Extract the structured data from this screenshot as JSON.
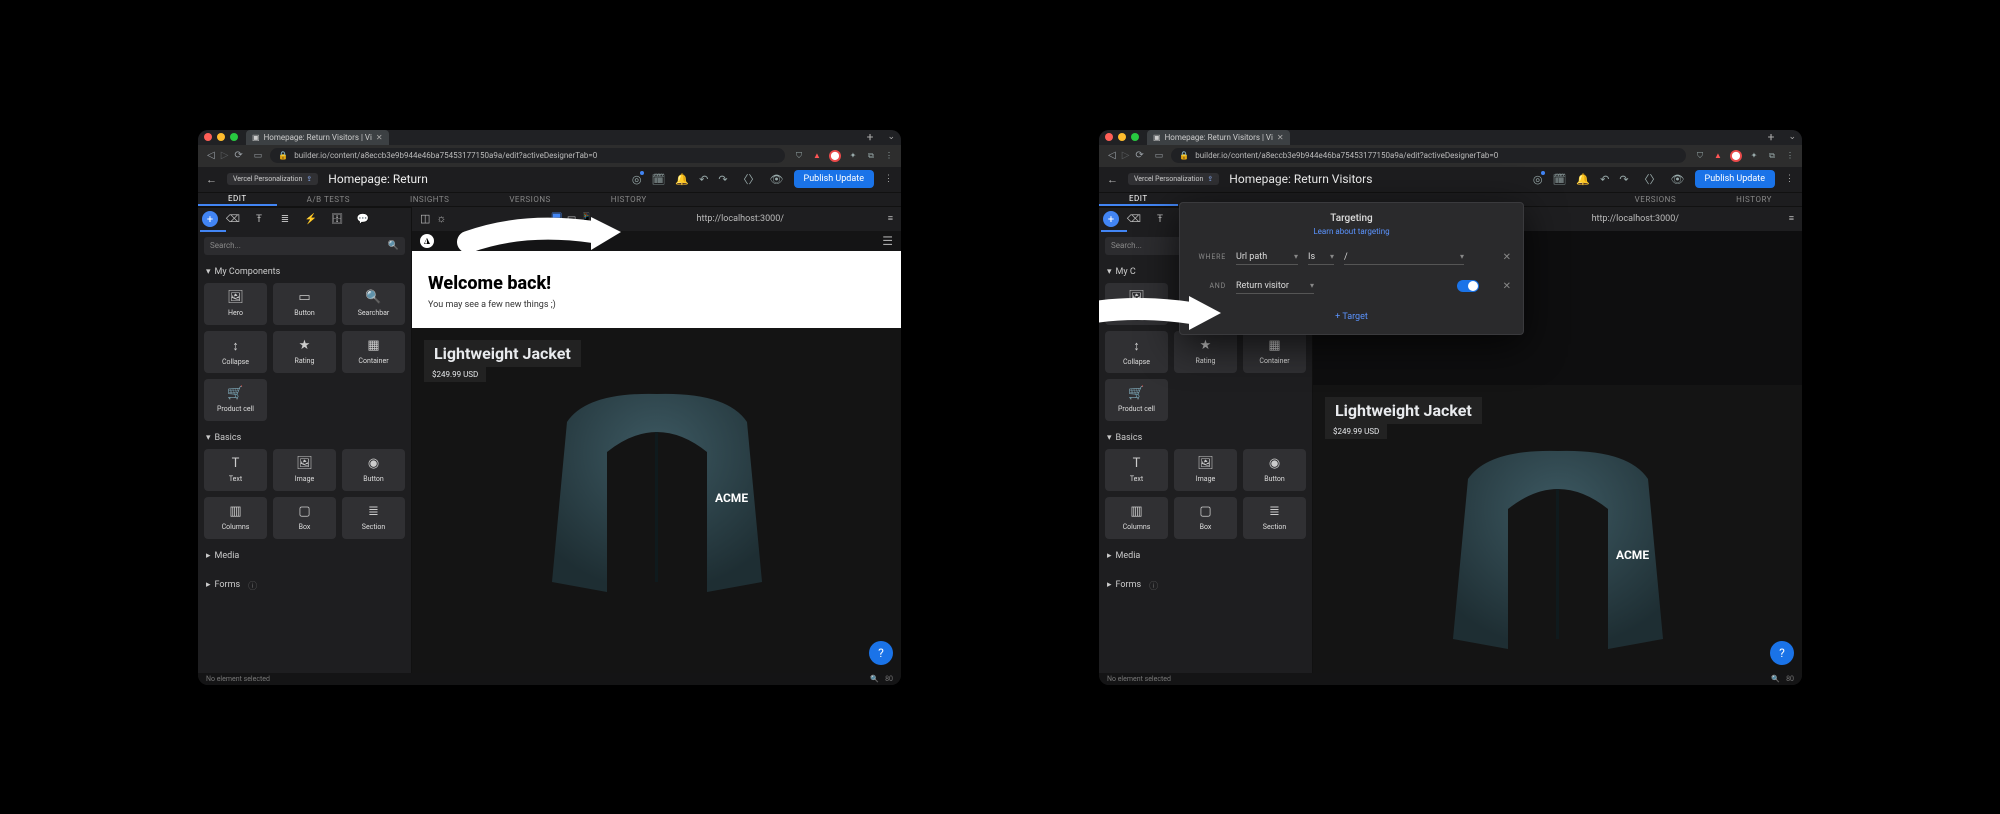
{
  "browser": {
    "tab_title": "Homepage: Return Visitors | Vi",
    "url_display": "builder.io/content/a8eccb3e9b944e46ba75453177150a9a/edit?activeDesignerTab=0"
  },
  "header": {
    "back_label": "Vercel Personalization",
    "page_title_short": "Homepage: Return",
    "page_title_full": "Homepage: Return Visitors",
    "publish": "Publish Update"
  },
  "mode_tabs": {
    "edit": "EDIT",
    "ab": "A/B TESTS",
    "insights": "INSIGHTS",
    "versions": "VERSIONS",
    "history": "HISTORY"
  },
  "preview": {
    "url": "http://localhost:3000/",
    "welcome_heading": "Welcome back!",
    "welcome_sub": "You may see a few new things ;)",
    "product_title": "Lightweight Jacket",
    "product_price": "$249.99 USD",
    "brand": "ACME"
  },
  "sidebar": {
    "search_placeholder": "Search...",
    "groups": {
      "my_components": {
        "label": "My Components",
        "tiles": [
          "Hero",
          "Button",
          "Searchbar",
          "Collapse",
          "Rating",
          "Container",
          "Product cell"
        ]
      },
      "basics": {
        "label": "Basics",
        "tiles": [
          "Text",
          "Image",
          "Button",
          "Columns",
          "Box",
          "Section"
        ]
      },
      "media": {
        "label": "Media"
      },
      "forms": {
        "label": "Forms"
      }
    }
  },
  "targeting": {
    "title": "Targeting",
    "learn": "Learn about targeting",
    "where": "WHERE",
    "and": "AND",
    "field_url": "Url path",
    "op_is": "Is",
    "val_slash": "/",
    "field_return": "Return visitor",
    "add": "+ Target"
  },
  "status": {
    "no_element": "No element selected",
    "count": "80"
  }
}
